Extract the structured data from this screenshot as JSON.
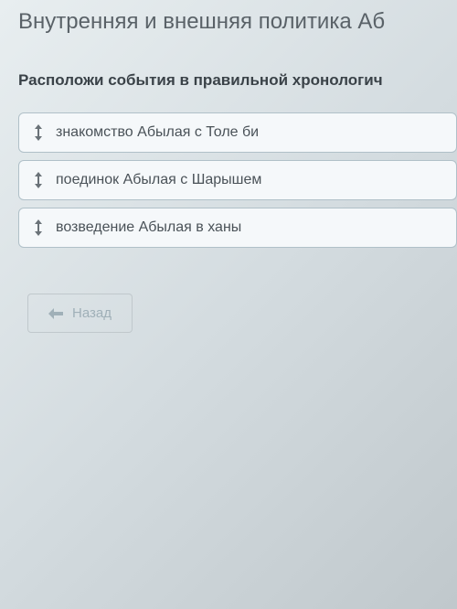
{
  "title": "Внутренняя и внешняя политика Аб",
  "instruction": "Расположи события в правильной хронологич",
  "items": [
    {
      "text": "знакомство Абылая с Толе би"
    },
    {
      "text": "поединок Абылая с Шарышем"
    },
    {
      "text": "возведение Абылая в ханы"
    }
  ],
  "buttons": {
    "back": "Назад"
  }
}
